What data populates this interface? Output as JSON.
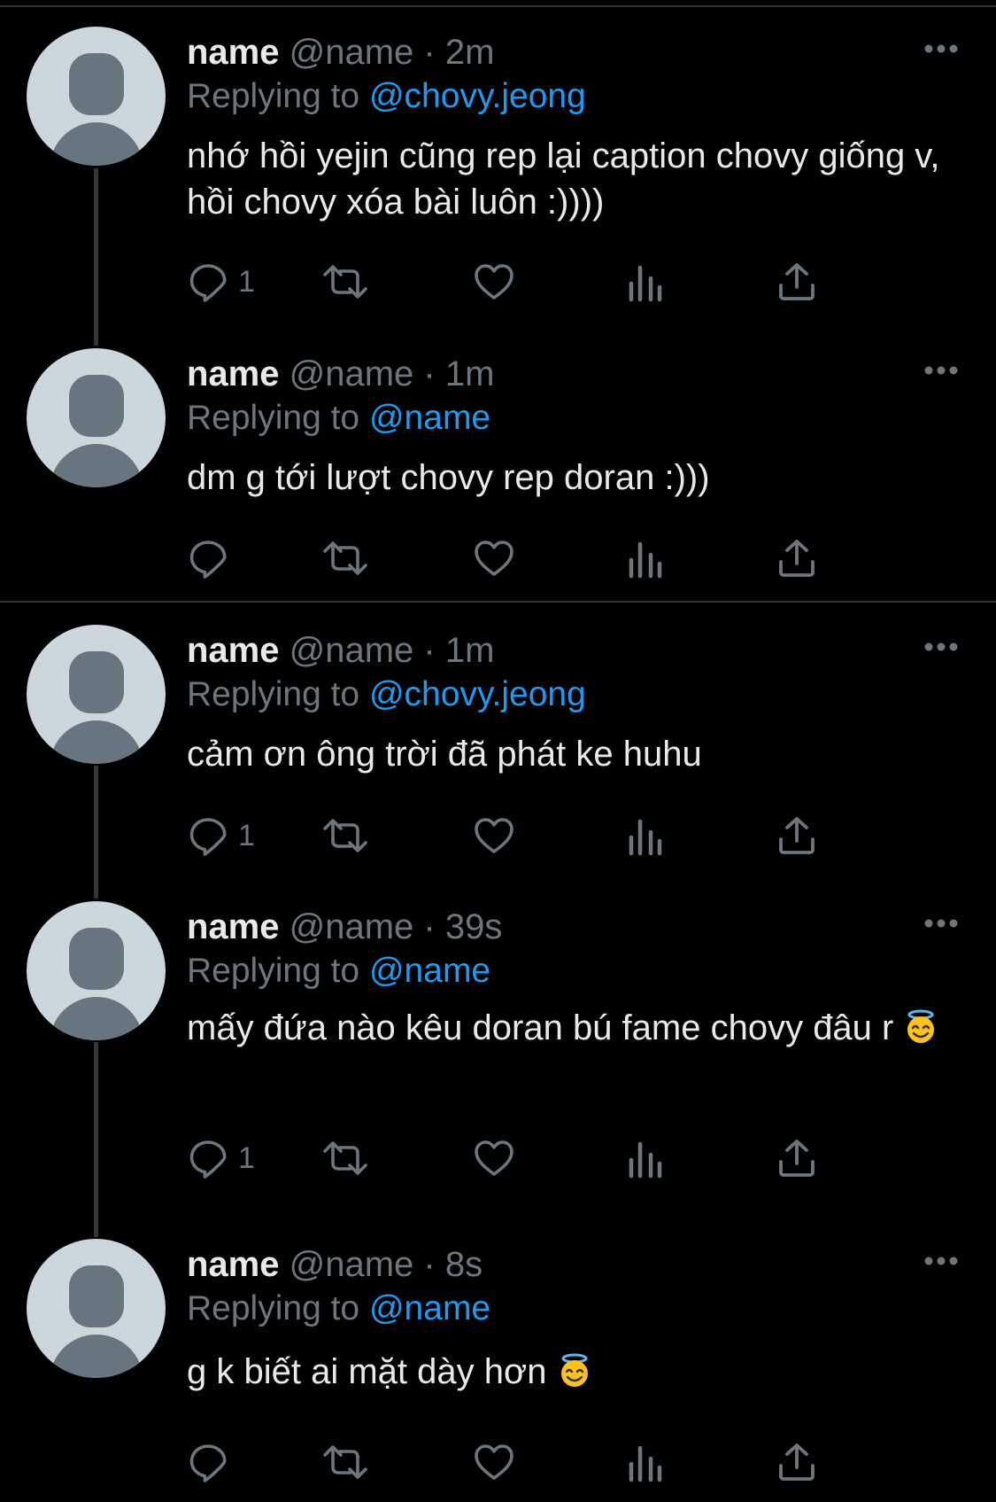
{
  "tweets": [
    {
      "name": "name",
      "handle": "@name",
      "dot": "·",
      "time": "2m",
      "replying_label": "Replying to",
      "replying_to": "@chovy.jeong",
      "text": "nhớ hồi yejin cũng rep lại caption chovy giống v, hồi chovy xóa bài luôn :))))",
      "reply_count": "1"
    },
    {
      "name": "name",
      "handle": "@name",
      "dot": "·",
      "time": "1m",
      "replying_label": "Replying to",
      "replying_to": "@name",
      "text": "dm g tới lượt chovy rep doran :)))",
      "reply_count": ""
    },
    {
      "name": "name",
      "handle": "@name",
      "dot": "·",
      "time": "1m",
      "replying_label": "Replying to",
      "replying_to": "@chovy.jeong",
      "text": "cảm ơn ông trời đã phát ke huhu",
      "reply_count": "1"
    },
    {
      "name": "name",
      "handle": "@name",
      "dot": "·",
      "time": "39s",
      "replying_label": "Replying to",
      "replying_to": "@name",
      "text": "mấy đứa nào kêu doran bú fame chovy đâu r",
      "emoji": "smiling-face-with-halo",
      "reply_count": "1"
    },
    {
      "name": "name",
      "handle": "@name",
      "dot": "·",
      "time": "8s",
      "replying_label": "Replying to",
      "replying_to": "@name",
      "text": "g k biết ai mặt dày hơn",
      "emoji": "smiling-face-with-halo",
      "reply_count": ""
    }
  ],
  "colors": {
    "background": "#000000",
    "primary_text": "#e7e9ea",
    "secondary_text": "#6e767d",
    "link": "#1d9bf0",
    "separator": "#2f3336",
    "avatar_bg": "#ccd6dd",
    "avatar_fg": "#66757f"
  },
  "icons": [
    "reply-icon",
    "retweet-icon",
    "like-icon",
    "views-icon",
    "share-icon",
    "more-icon",
    "halo-emoji"
  ]
}
